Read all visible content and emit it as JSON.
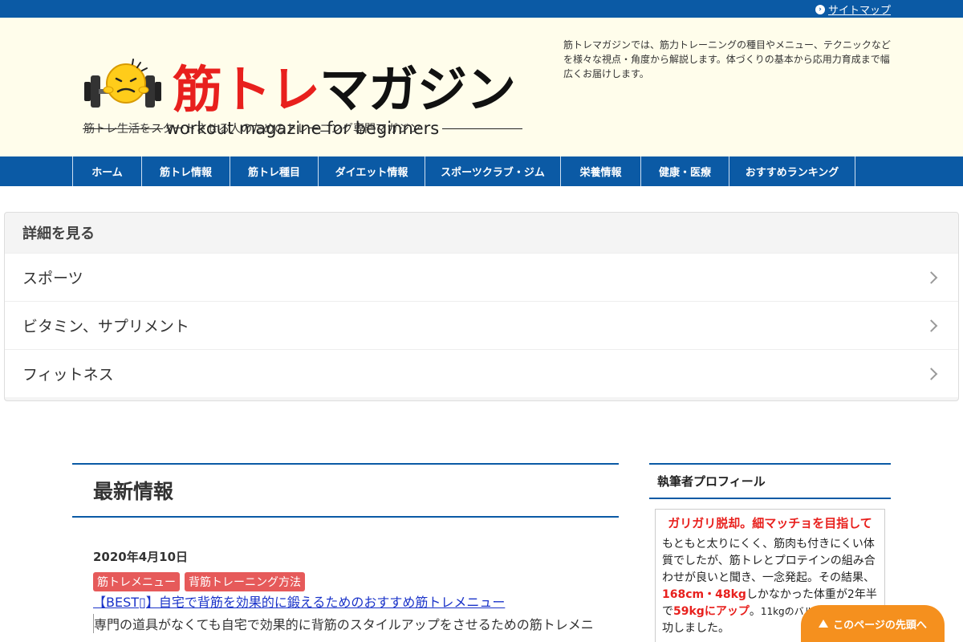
{
  "topbar": {
    "sitemap_label": "サイトマップ"
  },
  "header": {
    "logo_title_red": "筋トレ",
    "logo_title_black": "マガジン",
    "logo_subtitle": "workout magazine for beginners",
    "tagline": "筋トレ生活をスタートさせる人のためのトレーニング専門マガジン",
    "description": "筋トレマガジンでは、筋力トレーニングの種目やメニュー、テクニックなどを様々な視点・角度から解説します。体づくりの基本から応用力育成まで幅広くお届けします。"
  },
  "nav": {
    "items": [
      {
        "label": "ホーム"
      },
      {
        "label": "筋トレ情報"
      },
      {
        "label": "筋トレ種目"
      },
      {
        "label": "ダイエット情報"
      },
      {
        "label": "スポーツクラブ・ジム"
      },
      {
        "label": "栄養情報"
      },
      {
        "label": "健康・医療"
      },
      {
        "label": "おすすめランキング"
      }
    ]
  },
  "details": {
    "heading": "詳細を見る",
    "items": [
      {
        "label": "スポーツ"
      },
      {
        "label": "ビタミン、サプリメント"
      },
      {
        "label": "フィットネス"
      }
    ]
  },
  "main": {
    "heading": "最新情報",
    "post": {
      "date": "2020年4月10日",
      "tags": [
        "筋トレメニュー",
        "背筋トレーニング方法"
      ],
      "title": "【BEST▯】自宅で背筋を効果的に鍛えるためのおすすめ筋トレメニュー",
      "excerpt": "専門の道具がなくても自宅で効果的に背筋のスタイルアップをさせるための筋トレメニ"
    }
  },
  "sidebar": {
    "heading": "執筆者プロフィール",
    "profile_title": "ガリガリ脱却。細マッチョを目指して",
    "profile_text_1": "もともと太りにくく、筋肉も付きにくい体質でしたが、筋トレとプロテインの組み合わせが良いと聞き、一念発起。その結果、",
    "profile_hl_1": "168cm・48kg",
    "profile_text_2": "しかなかった体重が2年半で",
    "profile_hl_2": "59kgにアップ",
    "profile_text_3": "。",
    "profile_small": "11kgのバル",
    "profile_text_4": "功しました。"
  },
  "totop": {
    "label": "このページの先頭へ"
  },
  "colors": {
    "brand_blue": "#0b5aa5",
    "accent_red": "#e8201d",
    "tag_red": "#e65a5a",
    "totop_orange": "#f5901e",
    "header_bg": "#fffdeb"
  }
}
